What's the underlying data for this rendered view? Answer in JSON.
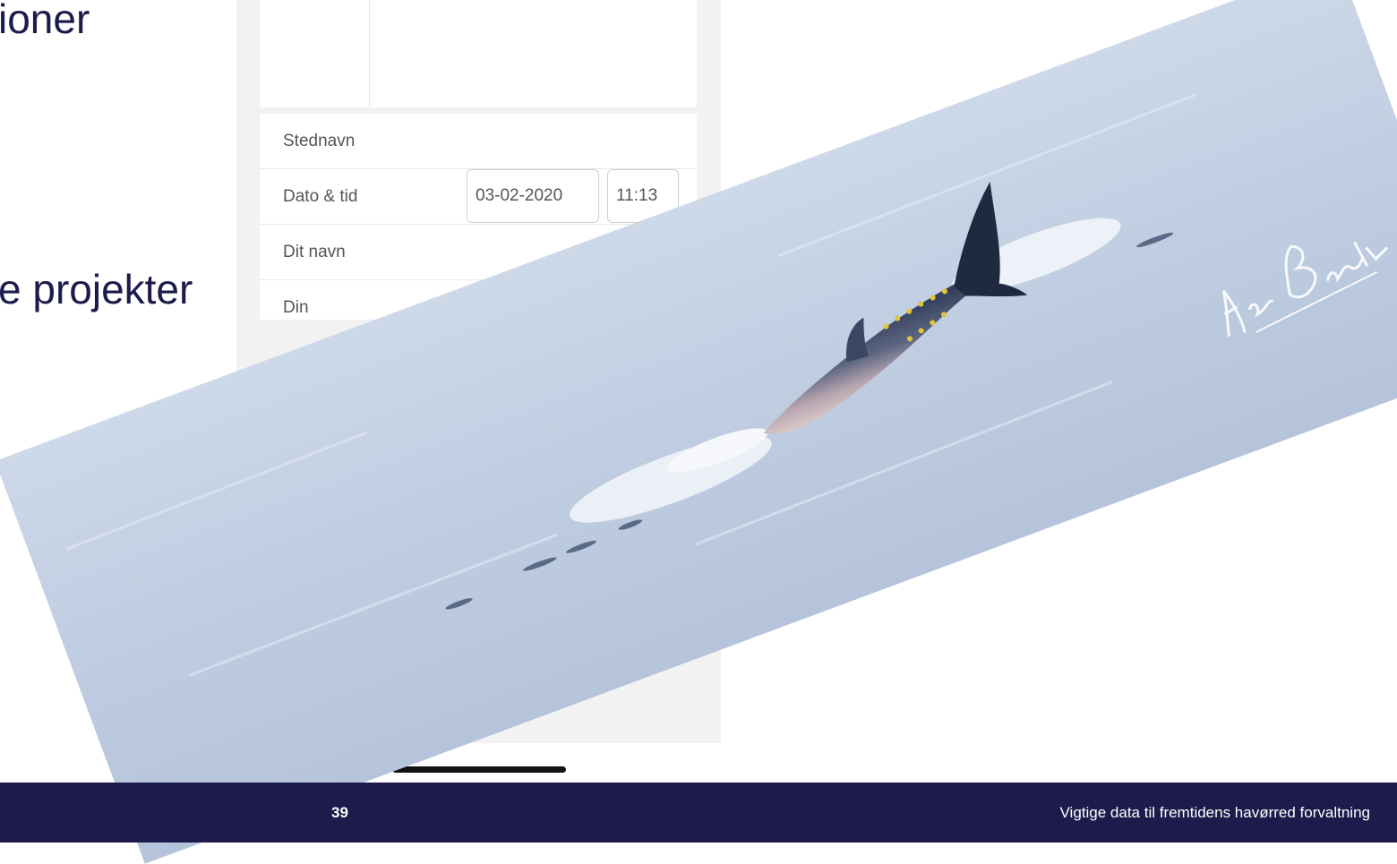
{
  "slide": {
    "bullet_fragment_1": "ioner",
    "bullet_fragment_2": "e projekter"
  },
  "form": {
    "rows": [
      {
        "label": "Stednavn"
      },
      {
        "label": "Dato & tid",
        "date_value": "03-02-2020",
        "time_value": "11:13"
      },
      {
        "label": "Dit navn"
      },
      {
        "label": "Din"
      }
    ]
  },
  "photo": {
    "subject": "tuna-fish-jumping",
    "watermark_text": "Henrik Baktoft"
  },
  "footer": {
    "page_number": "39",
    "title": "Vigtige data til fremtidens havørred forvaltning"
  },
  "colors": {
    "brand_navy": "#1c1b4b",
    "page_background": "#ffffff",
    "phone_background": "#f2f2f2",
    "water": "#c4d0e3"
  }
}
